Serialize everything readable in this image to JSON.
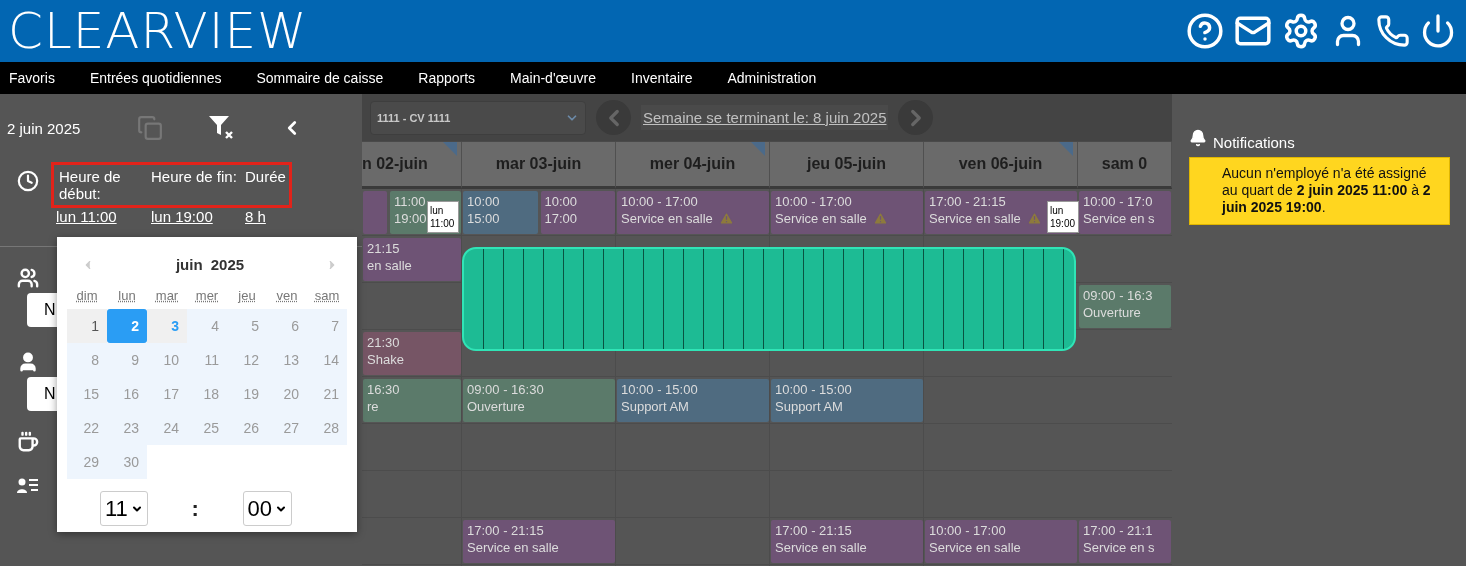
{
  "header": {
    "logo": "CLEARVIEW"
  },
  "menu": [
    "Favoris",
    "Entrées quotidiennes",
    "Sommaire de caisse",
    "Rapports",
    "Main-d'œuvre",
    "Inventaire",
    "Administration"
  ],
  "left_panel": {
    "date": "2 juin 2025",
    "time_labels": [
      "Heure de début:",
      "Heure de fin:",
      "Durée"
    ],
    "time_values": [
      "lun 11:00",
      "lun 19:00",
      "8 h"
    ],
    "selects": [
      {
        "value": "N"
      },
      {
        "value": "N"
      }
    ]
  },
  "calendar": {
    "month": "juin",
    "year": "2025",
    "weekdays": [
      "dim",
      "lun",
      "mar",
      "mer",
      "jeu",
      "ven",
      "sam"
    ],
    "days": [
      {
        "label": "1",
        "selected": false,
        "today": false,
        "disabled": false
      },
      {
        "label": "2",
        "selected": true,
        "today": false,
        "disabled": false
      },
      {
        "label": "3",
        "selected": false,
        "today": true,
        "disabled": false
      },
      {
        "label": "4",
        "selected": false,
        "today": false,
        "disabled": true
      },
      {
        "label": "5",
        "selected": false,
        "today": false,
        "disabled": true
      },
      {
        "label": "6",
        "selected": false,
        "today": false,
        "disabled": true
      },
      {
        "label": "7",
        "selected": false,
        "today": false,
        "disabled": true
      },
      {
        "label": "8",
        "selected": false,
        "today": false,
        "disabled": true
      },
      {
        "label": "9",
        "selected": false,
        "today": false,
        "disabled": true
      },
      {
        "label": "10",
        "selected": false,
        "today": false,
        "disabled": true
      },
      {
        "label": "11",
        "selected": false,
        "today": false,
        "disabled": true
      },
      {
        "label": "12",
        "selected": false,
        "today": false,
        "disabled": true
      },
      {
        "label": "13",
        "selected": false,
        "today": false,
        "disabled": true
      },
      {
        "label": "14",
        "selected": false,
        "today": false,
        "disabled": true
      },
      {
        "label": "15",
        "selected": false,
        "today": false,
        "disabled": true
      },
      {
        "label": "16",
        "selected": false,
        "today": false,
        "disabled": true
      },
      {
        "label": "17",
        "selected": false,
        "today": false,
        "disabled": true
      },
      {
        "label": "18",
        "selected": false,
        "today": false,
        "disabled": true
      },
      {
        "label": "19",
        "selected": false,
        "today": false,
        "disabled": true
      },
      {
        "label": "20",
        "selected": false,
        "today": false,
        "disabled": true
      },
      {
        "label": "21",
        "selected": false,
        "today": false,
        "disabled": true
      },
      {
        "label": "22",
        "selected": false,
        "today": false,
        "disabled": true
      },
      {
        "label": "23",
        "selected": false,
        "today": false,
        "disabled": true
      },
      {
        "label": "24",
        "selected": false,
        "today": false,
        "disabled": true
      },
      {
        "label": "25",
        "selected": false,
        "today": false,
        "disabled": true
      },
      {
        "label": "26",
        "selected": false,
        "today": false,
        "disabled": true
      },
      {
        "label": "27",
        "selected": false,
        "today": false,
        "disabled": true
      },
      {
        "label": "28",
        "selected": false,
        "today": false,
        "disabled": true
      },
      {
        "label": "29",
        "selected": false,
        "today": false,
        "disabled": true
      },
      {
        "label": "30",
        "selected": false,
        "today": false,
        "disabled": true
      }
    ],
    "hour": "11",
    "separator": ":",
    "minute": "00"
  },
  "schedule": {
    "store": "1111 - CV 1111",
    "week_label": "Semaine se terminant le: 8 juin 2025",
    "days": [
      {
        "label": "n 02-juin",
        "flagged": true
      },
      {
        "label": "mar 03-juin",
        "flagged": false
      },
      {
        "label": "mer 04-juin",
        "flagged": true
      },
      {
        "label": "jeu 05-juin",
        "flagged": false
      },
      {
        "label": "ven 06-juin",
        "flagged": true
      },
      {
        "label": "sam 0",
        "flagged": false
      }
    ],
    "rows": [
      [
        [
          {
            "color": "#6e5375"
          },
          {
            "lines": [
              "11:00",
              "19:00"
            ],
            "color": "#5b7a6a"
          }
        ],
        [
          {
            "lines": [
              "10:00",
              "15:00"
            ],
            "color": "#4f6b80",
            "warning": false
          },
          {
            "lines": [
              "10:00",
              "17:00"
            ],
            "color": "#6e5375",
            "warning": false
          }
        ],
        [
          {
            "lines": [
              "10:00 - 17:00",
              "Service en salle"
            ],
            "color": "#6e5375",
            "warning": true
          }
        ],
        [
          {
            "lines": [
              "10:00 - 17:00",
              "Service en salle"
            ],
            "color": "#6e5375",
            "warning": true
          }
        ],
        [
          {
            "lines": [
              "17:00 - 21:15",
              "Service en salle"
            ],
            "color": "#6e5375",
            "warning": true
          }
        ],
        [
          {
            "lines": [
              "10:00 - 17:0",
              "Service en s"
            ],
            "color": "#6e5375",
            "warning": false
          }
        ]
      ],
      [
        [
          {
            "lines": [
              "21:15",
              "en salle"
            ],
            "color": "#6e5375",
            "warning": false
          }
        ],
        [],
        [],
        [],
        [],
        []
      ],
      [
        [],
        [],
        [],
        [],
        [],
        [
          {
            "lines": [
              "09:00 - 16:3",
              "Ouverture"
            ],
            "color": "#5b7a6a",
            "warning": false
          }
        ]
      ],
      [
        [
          {
            "lines": [
              "21:30",
              "Shake"
            ],
            "color": "#765565",
            "warning": false
          }
        ],
        [],
        [],
        [],
        [],
        []
      ],
      [
        [
          {
            "lines": [
              "16:30",
              "re"
            ],
            "color": "#5b7a6a",
            "warning": false
          }
        ],
        [
          {
            "lines": [
              "09:00 - 16:30",
              "Ouverture"
            ],
            "color": "#5b7a6a",
            "warning": false
          }
        ],
        [
          {
            "lines": [
              "10:00 - 15:00",
              "Support AM"
            ],
            "color": "#4f6b80",
            "warning": false
          }
        ],
        [
          {
            "lines": [
              "10:00 - 15:00",
              "Support AM"
            ],
            "color": "#4f6b80",
            "warning": false
          }
        ],
        [],
        []
      ],
      [
        [],
        [],
        [],
        [],
        [],
        []
      ],
      [
        [],
        [],
        [],
        [],
        [],
        []
      ],
      [
        [],
        [
          {
            "lines": [
              "17:00 - 21:15",
              "Service en salle"
            ],
            "color": "#6e5375",
            "warning": false
          }
        ],
        [],
        [
          {
            "lines": [
              "17:00 - 21:15",
              "Service en salle"
            ],
            "color": "#6e5375",
            "warning": false
          }
        ],
        [
          {
            "lines": [
              "10:00 - 17:00",
              "Service en salle"
            ],
            "color": "#6e5375",
            "warning": false
          }
        ],
        [
          {
            "lines": [
              "17:00 - 21:1",
              "Service en s"
            ],
            "color": "#6e5375",
            "warning": false
          }
        ]
      ]
    ],
    "selection": {
      "start": "lun 11:00",
      "end": "lun 19:00"
    }
  },
  "notifications": {
    "title": "Notifications",
    "message": "Aucun n'employé n'a été assigné au quart de **2 juin 2025 11:00** à **2 juin 2025 19:00**."
  }
}
